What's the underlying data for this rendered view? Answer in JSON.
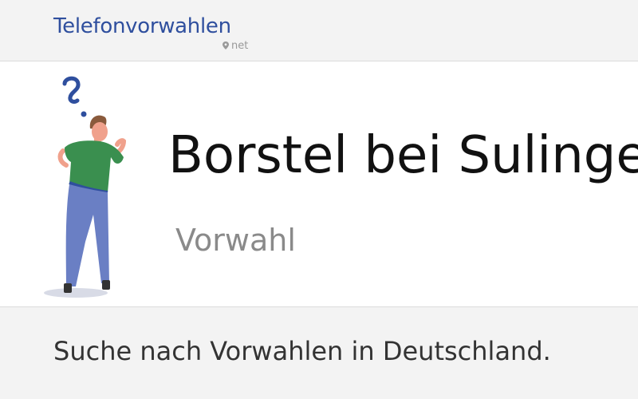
{
  "header": {
    "logo_text": "Telefonvorwahlen",
    "logo_sub": "net"
  },
  "hero": {
    "title": "Borstel bei Sulingen",
    "subtitle": "Vorwahl"
  },
  "main": {
    "search_heading": "Suche nach Vorwahlen in Deutschland."
  },
  "colors": {
    "brand": "#2f4f9e",
    "shirt": "#3a8f4f",
    "pants": "#6a7fc4"
  }
}
